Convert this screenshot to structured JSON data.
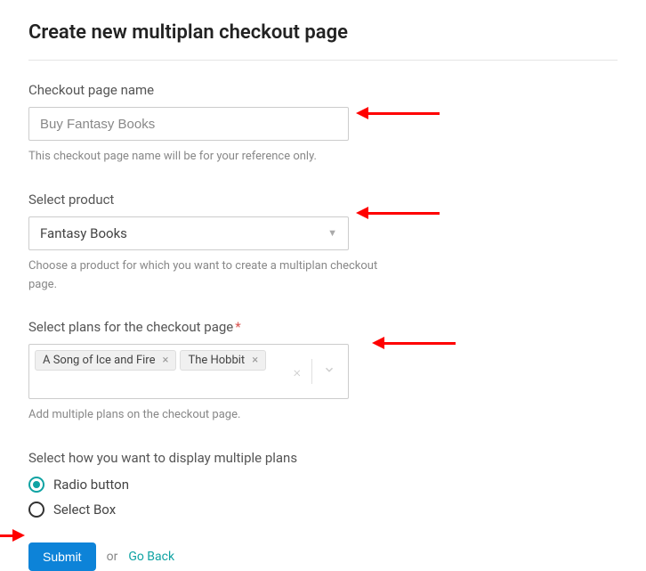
{
  "title": "Create new multiplan checkout page",
  "checkout_name": {
    "label": "Checkout page name",
    "value": "Buy Fantasy Books",
    "help": "This checkout page name will be for your reference only."
  },
  "product": {
    "label": "Select product",
    "value": "Fantasy Books",
    "help": "Choose a product for which you want to create a multiplan checkout page."
  },
  "plans": {
    "label": "Select plans for the checkout page",
    "tags": [
      "A Song of Ice and Fire",
      "The Hobbit"
    ],
    "help": "Add multiple plans on the checkout page."
  },
  "display": {
    "label": "Select how you want to display multiple plans",
    "options": [
      "Radio button",
      "Select Box"
    ],
    "selected": 0
  },
  "actions": {
    "submit": "Submit",
    "or": "or",
    "goback": "Go Back"
  }
}
